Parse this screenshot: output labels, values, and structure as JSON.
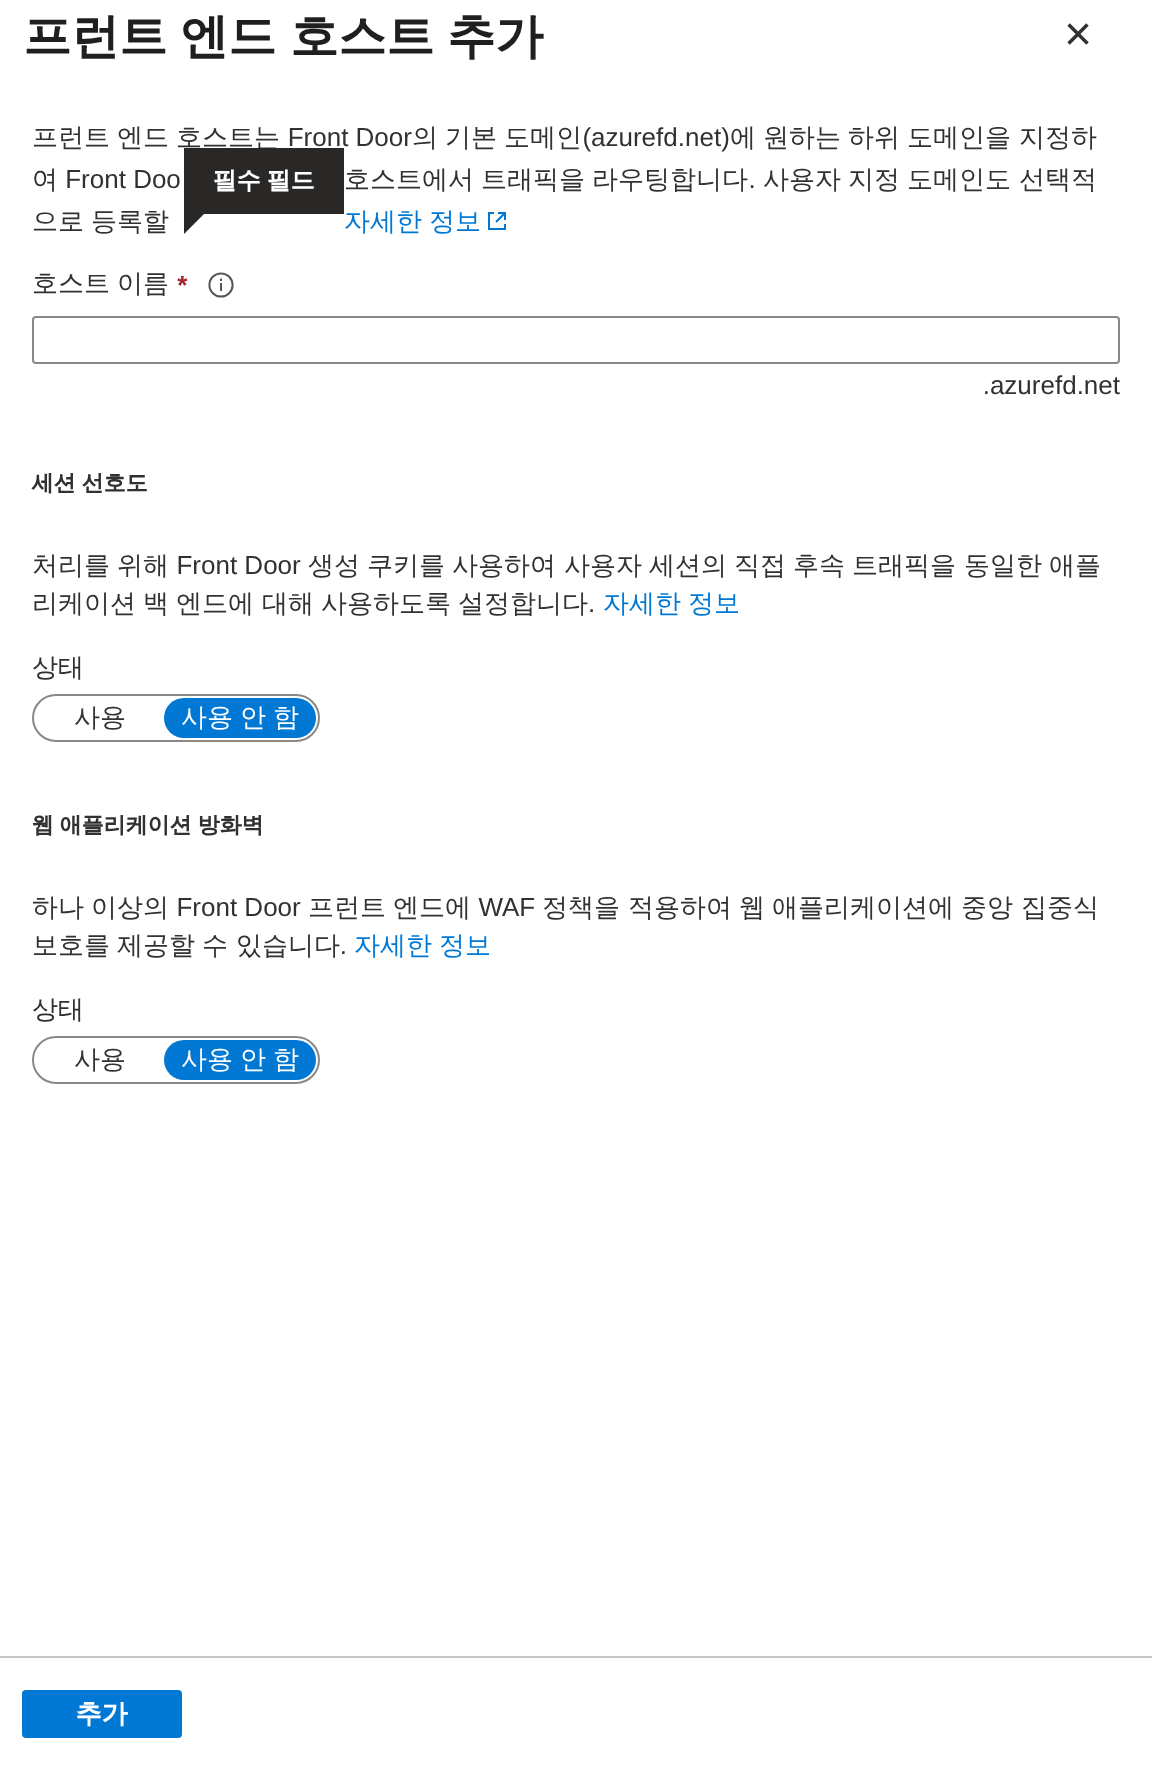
{
  "panel": {
    "title": "프런트 엔드 호스트 추가",
    "close": "×"
  },
  "description": {
    "line_1": "프런트 엔드 호스트는 Front Door의 기본 도메인(azurefd.net)에 원하는 하위 도메인을 지정하",
    "line_2_start": "여 Front Doo",
    "line_2_end": "호스트에서 트래픽을 라우팅합니다. 사용자 지정 도메인도 선택적",
    "line_3_start": "으로 등록할",
    "link": "자세한 정보"
  },
  "tooltip": {
    "text": "필수 필드"
  },
  "host_name": {
    "label": "호스트 이름",
    "required_mark": "*",
    "suffix": ".azurefd.net"
  },
  "sections": [
    {
      "heading": "세션 선호도",
      "text": "처리를 위해 Front Door 생성 쿠키를 사용하여 사용자 세션의 직접 후속 트래픽을 동일한 애플리케이션 백 엔드에 대해 사용하도록 설정합니다.",
      "link": "자세한 정보",
      "state_label": "상태",
      "options": [
        {
          "label": "사용",
          "selected": false
        },
        {
          "label": "사용 안 함",
          "selected": true
        }
      ]
    },
    {
      "heading": "웹 애플리케이션 방화벽",
      "text": "하나 이상의 Front Door 프런트 엔드에 WAF 정책을 적용하여 웹 애플리케이션에 중앙 집중식 보호를 제공할 수 있습니다.",
      "link": "자세한 정보",
      "state_label": "상태",
      "options": [
        {
          "label": "사용",
          "selected": false
        },
        {
          "label": "사용 안 함",
          "selected": true
        }
      ]
    }
  ],
  "footer": {
    "button": "추가"
  }
}
